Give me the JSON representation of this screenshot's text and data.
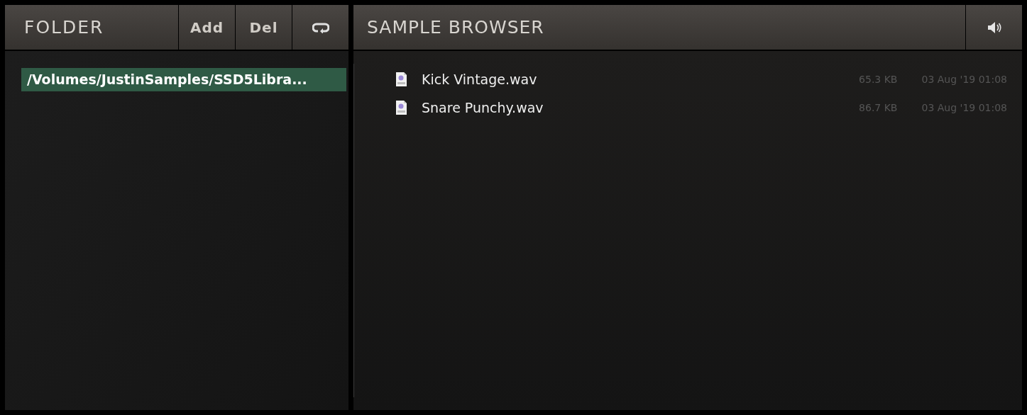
{
  "folder_panel": {
    "title": "FOLDER",
    "buttons": [
      {
        "kind": "text",
        "label": "Add"
      },
      {
        "kind": "text",
        "label": "Del"
      },
      {
        "kind": "loop"
      }
    ],
    "folders": [
      {
        "path": "/Volumes/JustinSamples/SSD5Libra...",
        "selected": true
      }
    ]
  },
  "sample_browser": {
    "title": "SAMPLE BROWSER",
    "files": [
      {
        "name": "Kick Vintage.wav",
        "size": "65.3 KB",
        "date": "03 Aug '19 01:08"
      },
      {
        "name": "Snare Punchy.wav",
        "size": "86.7 KB",
        "date": "03 Aug '19 01:08"
      }
    ]
  }
}
